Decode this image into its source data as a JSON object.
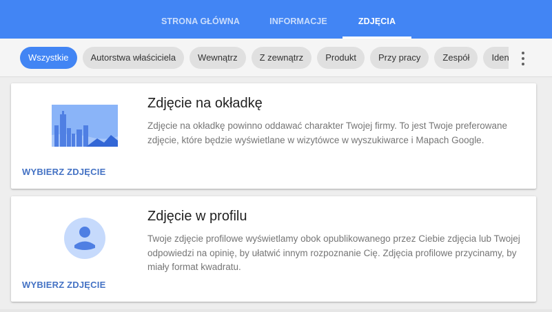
{
  "tabs": [
    {
      "label": "STRONA GŁÓWNA",
      "active": false
    },
    {
      "label": "INFORMACJE",
      "active": false
    },
    {
      "label": "ZDJĘCIA",
      "active": true
    }
  ],
  "filters": {
    "chips": [
      {
        "label": "Wszystkie",
        "active": true
      },
      {
        "label": "Autorstwa właściciela",
        "active": false
      },
      {
        "label": "Wewnątrz",
        "active": false
      },
      {
        "label": "Z zewnątrz",
        "active": false
      },
      {
        "label": "Produkt",
        "active": false
      },
      {
        "label": "Przy pracy",
        "active": false
      },
      {
        "label": "Zespół",
        "active": false
      },
      {
        "label": "Identyfikacja",
        "active": false
      }
    ],
    "more_icon": "more-vert-icon"
  },
  "cards": [
    {
      "title": "Zdjęcie na okładkę",
      "description": "Zdjęcie na okładkę powinno oddawać charakter Twojej firmy. To jest Twoje preferowane zdjęcie, które będzie wyświetlane w wizytówce w wyszukiwarce i Mapach Google.",
      "action": "WYBIERZ ZDJĘCIE",
      "icon": "cityscape-cover-icon"
    },
    {
      "title": "Zdjęcie w profilu",
      "description": "Twoje zdjęcie profilowe wyświetlamy obok opublikowanego przez Ciebie zdjęcia lub Twojej odpowiedzi na opinię, by ułatwić innym rozpoznanie Cię. Zdjęcia profilowe przycinamy, by miały format kwadratu.",
      "action": "WYBIERZ ZDJĘCIE",
      "icon": "profile-avatar-icon"
    }
  ],
  "colors": {
    "primary": "#4285f4",
    "link": "#4472c4",
    "chip": "#e0e0e0",
    "background": "#eeeeee"
  }
}
